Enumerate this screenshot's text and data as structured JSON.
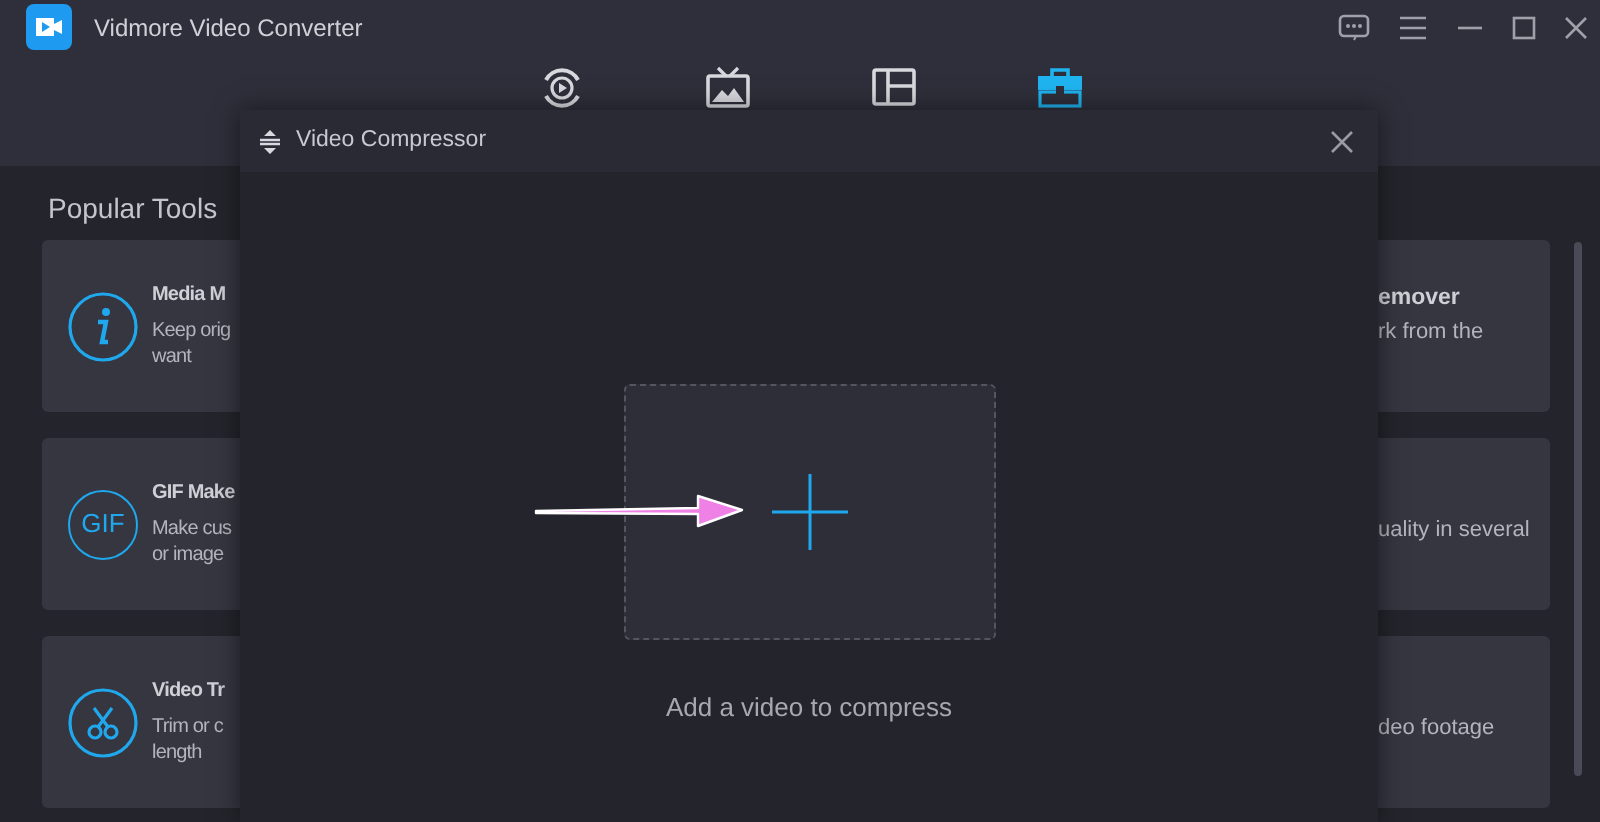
{
  "window": {
    "title": "Vidmore Video Converter"
  },
  "title_bar_buttons": [
    {
      "kind": "feedback"
    },
    {
      "kind": "menu"
    },
    {
      "kind": "minimize"
    },
    {
      "kind": "maximize"
    },
    {
      "kind": "close"
    }
  ],
  "tabs": [
    {
      "kind": "converter",
      "selected": false
    },
    {
      "kind": "mv",
      "selected": false
    },
    {
      "kind": "collage",
      "selected": false
    },
    {
      "kind": "toolbox",
      "selected": true
    }
  ],
  "section_title": "Popular Tools",
  "left_cards": [
    {
      "kind": "info",
      "title": "Media M",
      "lines": [
        "Keep orig",
        "want"
      ]
    },
    {
      "kind": "gif",
      "icon_text": "GIF",
      "title": "GIF Make",
      "lines": [
        "Make cus",
        "or image"
      ]
    },
    {
      "kind": "trim",
      "title": "Video Tr",
      "lines": [
        "Trim or c",
        "length"
      ]
    }
  ],
  "right_cards": [
    {
      "title": "emover",
      "lines": [
        "rk from the"
      ]
    },
    {
      "lines": [
        "uality in several"
      ]
    },
    {
      "lines": [
        "deo footage"
      ]
    }
  ],
  "dialog": {
    "title": "Video Compressor",
    "drop_hint": "Add a video to compress"
  }
}
